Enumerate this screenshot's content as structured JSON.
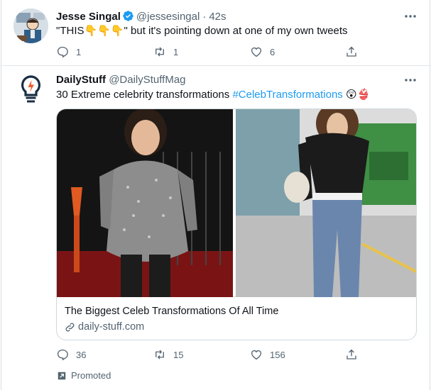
{
  "tweets": [
    {
      "display_name": "Jesse Singal",
      "handle": "@jessesingal",
      "separator": "·",
      "time": "42s",
      "text": "\"THIS👇👇👇\" but it's pointing down at one of my own tweets",
      "reply_count": "1",
      "retweet_count": "1",
      "like_count": "6"
    },
    {
      "display_name": "DailyStuff",
      "handle": "@DailyStuffMag",
      "text_before": "30 Extreme celebrity transformations ",
      "hashtag": "#CelebTransformations",
      "emoji": "😲👙",
      "card": {
        "title": "The Biggest Celeb Transformations Of All Time",
        "domain": "daily-stuff.com"
      },
      "reply_count": "36",
      "retweet_count": "15",
      "like_count": "156",
      "promoted_label": "Promoted"
    }
  ],
  "icons": {
    "verified": "verified-badge-icon",
    "more": "more-dots-icon",
    "reply": "reply-icon",
    "retweet": "retweet-icon",
    "like": "heart-icon",
    "share": "share-icon",
    "link": "link-icon",
    "promoted": "promoted-arrow-icon"
  },
  "colors": {
    "accent": "#1d9bf0",
    "text": "#0f1419",
    "muted": "#536471",
    "border": "#cfd9de"
  }
}
